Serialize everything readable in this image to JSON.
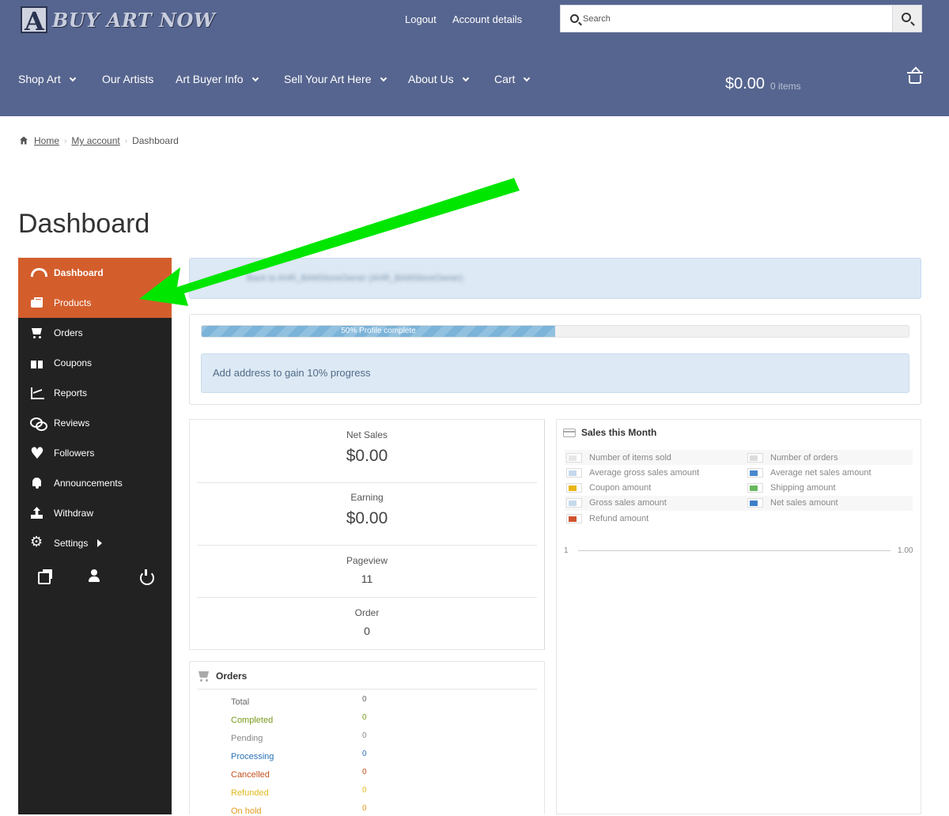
{
  "header": {
    "logo_text": "BUY ART NOW",
    "links": [
      "Logout",
      "Account details"
    ],
    "search": {
      "placeholder": "Search"
    },
    "nav": [
      {
        "label": "Shop Art",
        "dropdown": true
      },
      {
        "label": "Our Artists",
        "dropdown": false
      },
      {
        "label": "Art Buyer Info",
        "dropdown": true
      },
      {
        "label": "Sell Your Art Here",
        "dropdown": true
      },
      {
        "label": "About Us",
        "dropdown": true
      },
      {
        "label": "Cart",
        "dropdown": true
      }
    ],
    "cart": {
      "total": "$0.00",
      "count": "0 items"
    }
  },
  "breadcrumb": {
    "home": "Home",
    "account": "My account",
    "current": "Dashboard"
  },
  "page_title": "Dashboard",
  "sidebar": {
    "items": [
      {
        "label": "Dashboard",
        "icon": "dashboard-icon",
        "active": true
      },
      {
        "label": "Products",
        "icon": "briefcase-icon",
        "active": true
      },
      {
        "label": "Orders",
        "icon": "cart-icon"
      },
      {
        "label": "Coupons",
        "icon": "gift-icon"
      },
      {
        "label": "Reports",
        "icon": "chart-icon"
      },
      {
        "label": "Reviews",
        "icon": "comments-icon"
      },
      {
        "label": "Followers",
        "icon": "heart-icon"
      },
      {
        "label": "Announcements",
        "icon": "bell-icon"
      },
      {
        "label": "Withdraw",
        "icon": "upload-icon"
      },
      {
        "label": "Settings",
        "icon": "gear-icon"
      }
    ],
    "bottom_icons": [
      "external-link-icon",
      "user-icon",
      "power-icon"
    ]
  },
  "notice": {
    "text": "Back to AHR_BAMStoreOwner (AHR_BAMStoreOwner)"
  },
  "profile": {
    "progress": 0.5,
    "label": "50% Profile complete",
    "hint": "Add address to gain 10% progress"
  },
  "summary": {
    "net_sales_label": "Net Sales",
    "net_sales": "$0.00",
    "earning_label": "Earning",
    "earning": "$0.00",
    "pageview_label": "Pageview",
    "pageview": "11",
    "order_label": "Order",
    "order": "0"
  },
  "sales_month": {
    "title": "Sales this Month",
    "legend": [
      {
        "label": "Number of items sold",
        "color": "#e6e6e6"
      },
      {
        "label": "Number of orders",
        "color": "#dcdcdc"
      },
      {
        "label": "Average gross sales amount",
        "color": "#c6d8ec"
      },
      {
        "label": "Average net sales amount",
        "color": "#4a88cc"
      },
      {
        "label": "Coupon amount",
        "color": "#e8b615"
      },
      {
        "label": "Shipping amount",
        "color": "#6ab85e"
      },
      {
        "label": "Gross sales amount",
        "color": "#c6d8ec"
      },
      {
        "label": "Net sales amount",
        "color": "#3d7fc8"
      },
      {
        "label": "Refund amount",
        "color": "#d0542f"
      }
    ],
    "axis_min": "1",
    "axis_max": "1.00"
  },
  "orders": {
    "title": "Orders",
    "rows": [
      {
        "label": "Total",
        "value": "0",
        "color": "#666666"
      },
      {
        "label": "Completed",
        "value": "0",
        "color": "#7a9b1c"
      },
      {
        "label": "Pending",
        "value": "0",
        "color": "#888888"
      },
      {
        "label": "Processing",
        "value": "0",
        "color": "#2a72b5"
      },
      {
        "label": "Cancelled",
        "value": "0",
        "color": "#c4521e"
      },
      {
        "label": "Refunded",
        "value": "0",
        "color": "#e0b91e"
      },
      {
        "label": "On hold",
        "value": "0",
        "color": "#e59a1f"
      }
    ]
  }
}
